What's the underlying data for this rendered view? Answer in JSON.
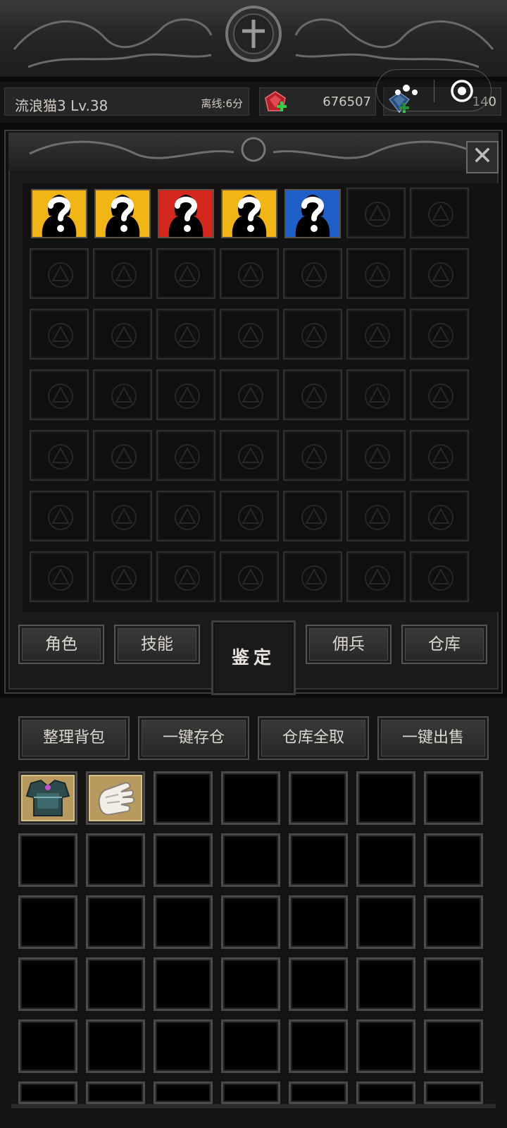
{
  "player": {
    "name": "流浪猫3 Lv.38",
    "offline": "离线:6分"
  },
  "currency": {
    "red_gem": "676507",
    "blue_gem": "140"
  },
  "stash": {
    "mystery_items": [
      {
        "color": "#f2b516"
      },
      {
        "color": "#f2b516"
      },
      {
        "color": "#d4281f"
      },
      {
        "color": "#f2b516"
      },
      {
        "color": "#1e5fc8"
      }
    ],
    "close_label": "✕"
  },
  "tabs": {
    "role": "角色",
    "skills": "技能",
    "identify": "鉴定",
    "mercenary": "佣兵",
    "warehouse": "仓库"
  },
  "actions": {
    "sort": "整理背包",
    "store_all": "一键存仓",
    "take_all": "仓库全取",
    "sell_all": "一键出售"
  },
  "inventory": {
    "items": [
      "armor-chestplate-icon",
      "gauntlet-icon"
    ]
  },
  "colors": {
    "mystery_yellow": "#f2b516",
    "mystery_red": "#d4281f",
    "mystery_blue": "#1e5fc8"
  }
}
